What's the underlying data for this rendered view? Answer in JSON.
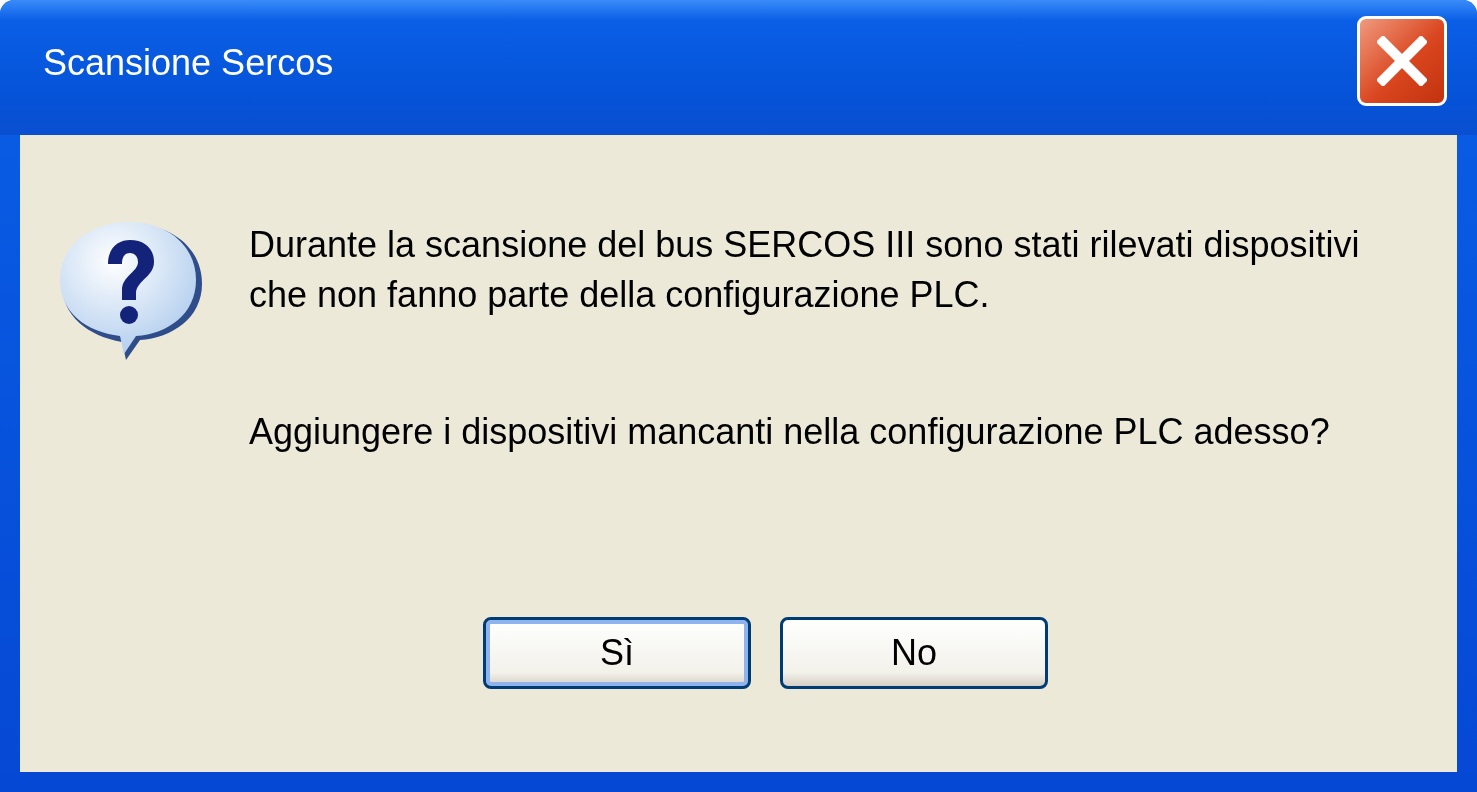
{
  "window": {
    "title": "Scansione Sercos"
  },
  "message": {
    "paragraphs": [
      "Durante la scansione del bus SERCOS III sono stati rilevati dispositivi che non fanno parte della configurazione PLC.",
      "Aggiungere i dispositivi mancanti nella configurazione PLC adesso?"
    ]
  },
  "buttons": [
    {
      "label": "Sì",
      "default": true
    },
    {
      "label": "No",
      "default": false
    }
  ]
}
